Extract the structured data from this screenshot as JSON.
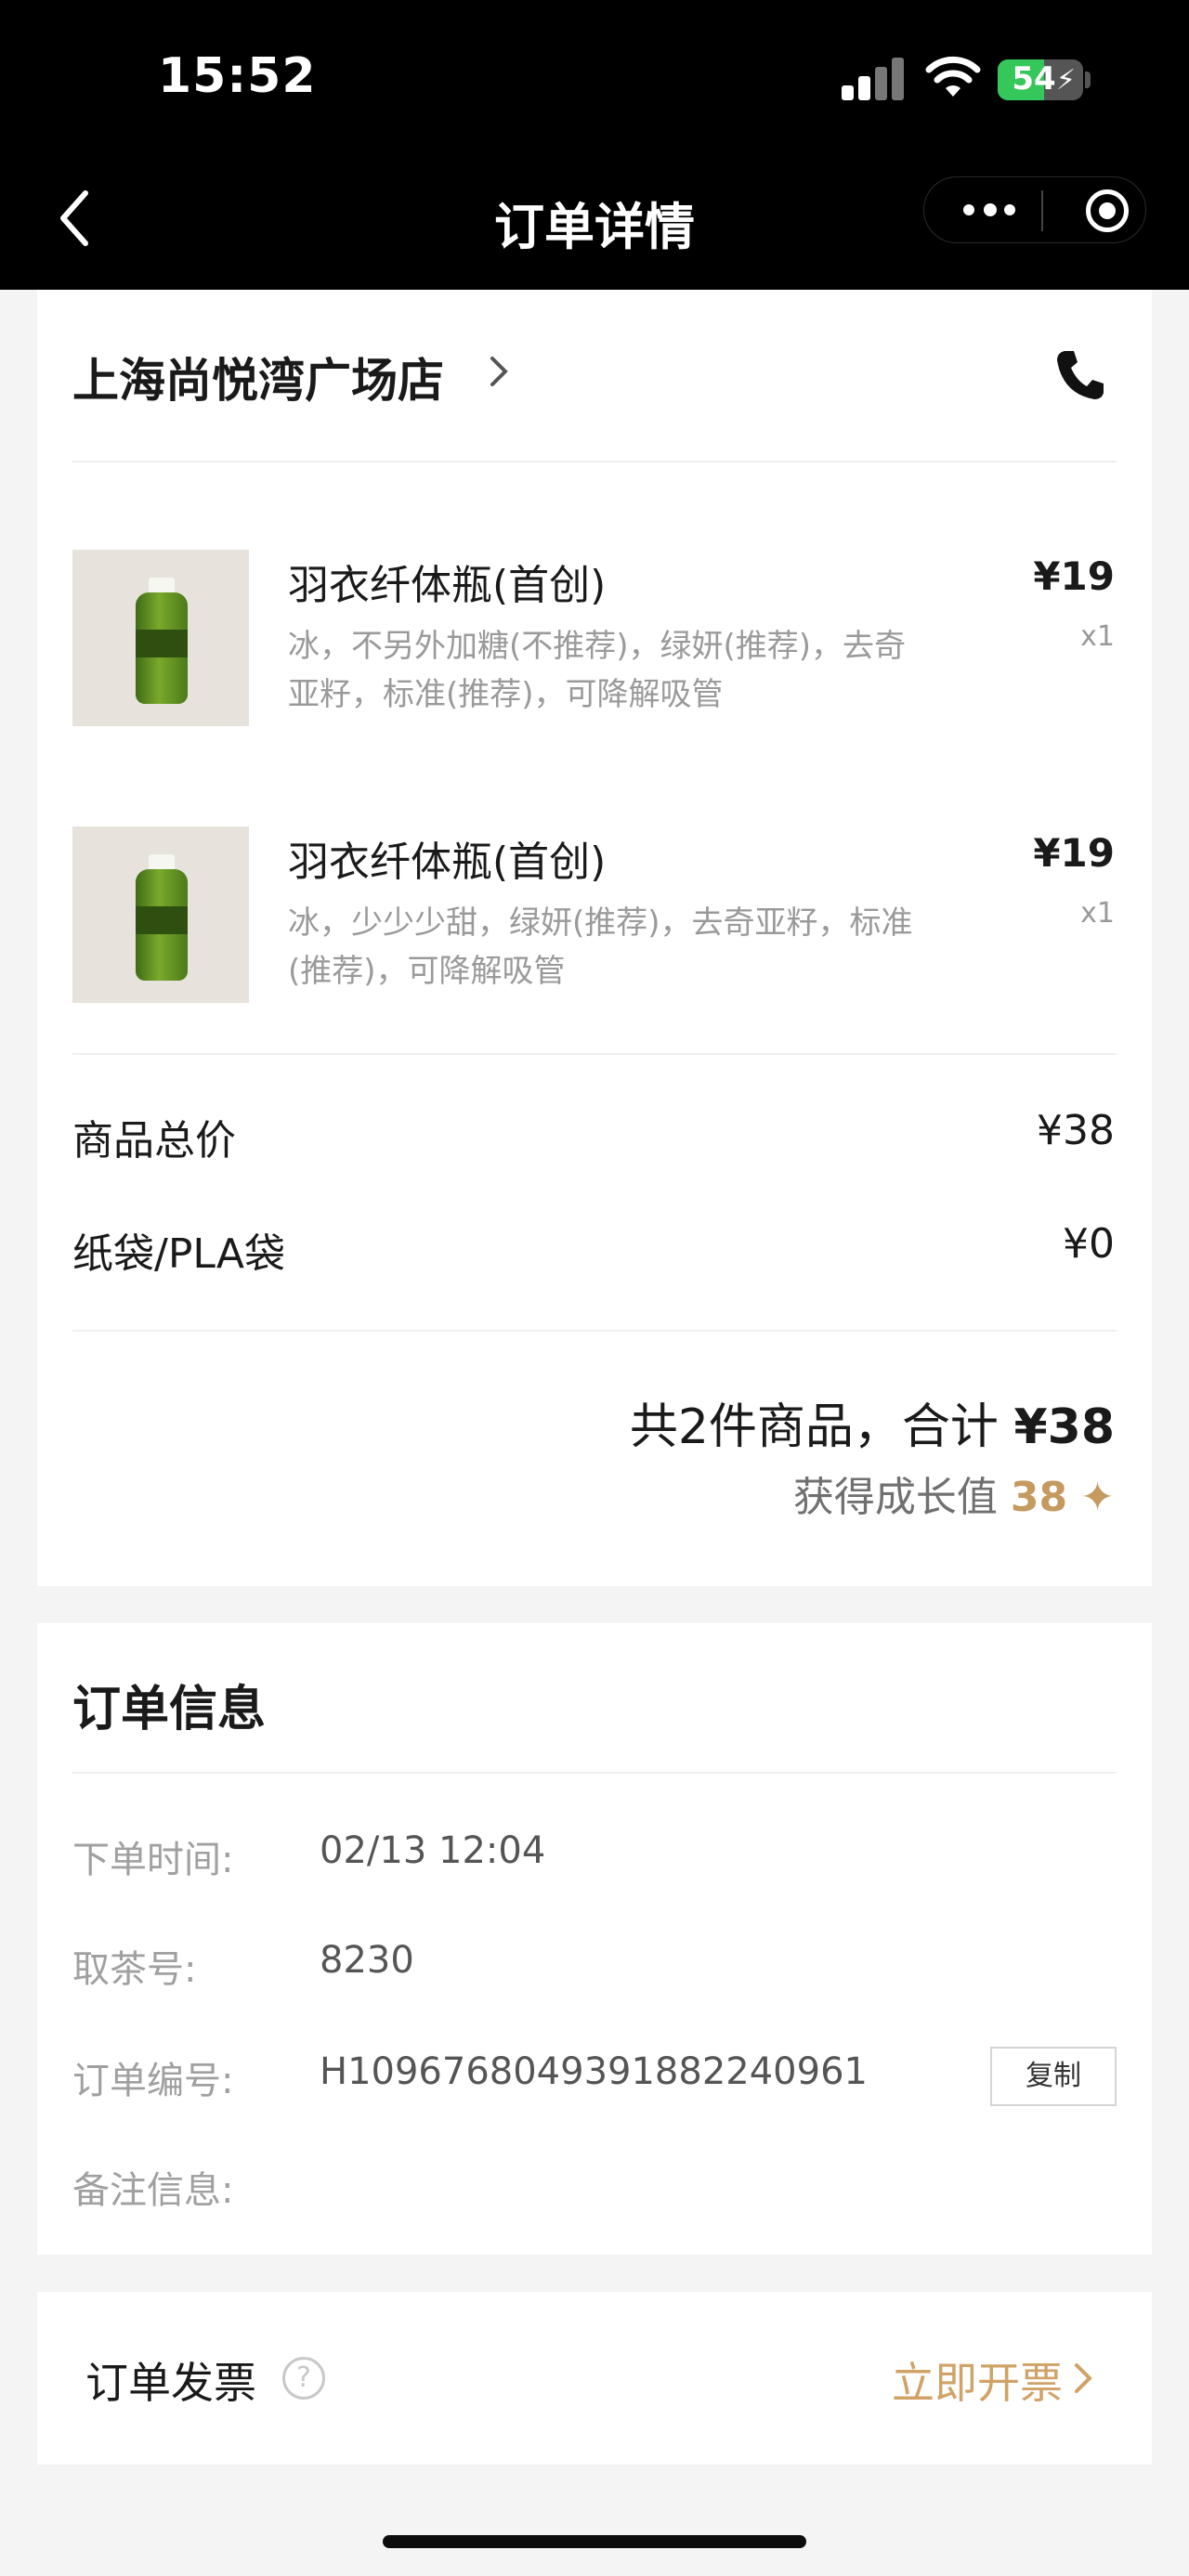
{
  "status_bar": {
    "time": "15:52",
    "battery": "54",
    "battery_level": 0.54
  },
  "nav": {
    "title": "订单详情",
    "icons": [
      "back-icon",
      "more-icon",
      "target-icon"
    ]
  },
  "store": {
    "name": "上海尚悦湾广场店",
    "icons": [
      "chevron-right-icon",
      "phone-icon"
    ]
  },
  "items": [
    {
      "name": "羽衣纤体瓶(首创)",
      "spec": "冰，不另外加糖(不推荐)，绿妍(推荐)，去奇亚籽，标准(推荐)，可降解吸管",
      "price": "¥19",
      "qty": "x1"
    },
    {
      "name": "羽衣纤体瓶(首创)",
      "spec": "冰，少少少甜，绿妍(推荐)，去奇亚籽，标准(推荐)，可降解吸管",
      "price": "¥19",
      "qty": "x1"
    }
  ],
  "fees": [
    {
      "label": "商品总价",
      "value": "¥38"
    },
    {
      "label": "纸袋/PLA袋",
      "value": "¥0"
    }
  ],
  "summary": {
    "prefix": "共2件商品，合计 ",
    "amount": "¥38",
    "growth_label": "获得成长值 ",
    "growth_value": "38",
    "growth_icon": "sparkle-icon"
  },
  "order_info": {
    "title": "订单信息",
    "rows": [
      {
        "label": "下单时间:",
        "value": "02/13 12:04"
      },
      {
        "label": "取茶号:",
        "value": "8230"
      },
      {
        "label": "订单编号:",
        "value": "H109676804939188224096​1"
      },
      {
        "label": "备注信息:",
        "value": ""
      }
    ],
    "copy_label": "复制"
  },
  "invoice": {
    "label": "订单发票",
    "help": "?",
    "link": "立即开票"
  },
  "colors": {
    "accent": "#c49a5f",
    "link": "#d0a266",
    "battery": "#35c759"
  }
}
